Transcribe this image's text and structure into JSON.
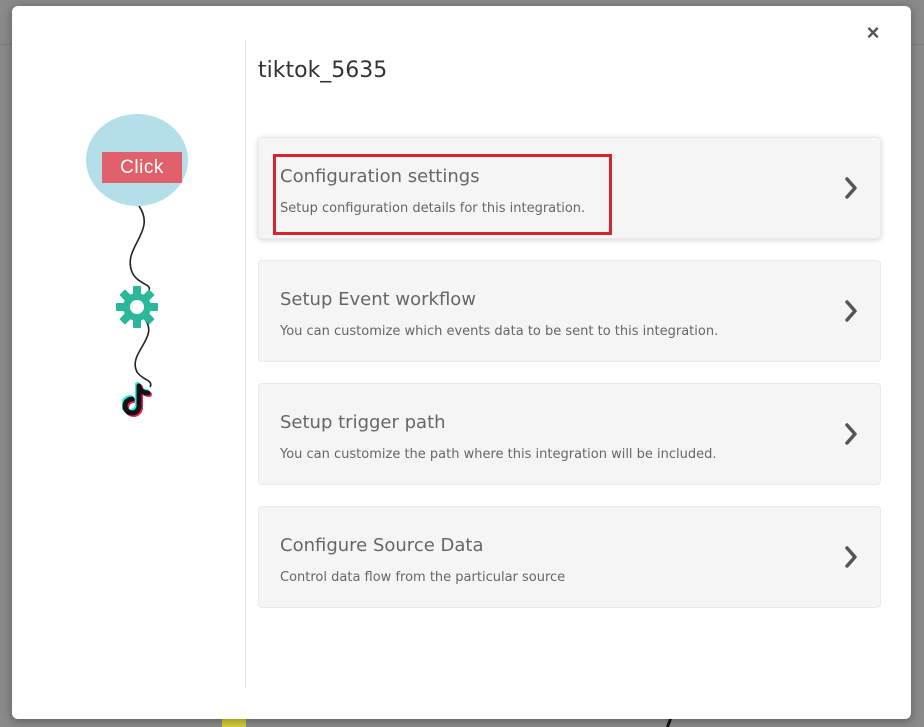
{
  "modal": {
    "title": "tiktok_5635",
    "close_label": "×"
  },
  "flow": {
    "start_label": "Click",
    "icons": [
      "click-node",
      "gear-icon",
      "tiktok-icon"
    ]
  },
  "cards": [
    {
      "title": "Configuration settings",
      "description": "Setup configuration details for this integration.",
      "highlighted": true
    },
    {
      "title": "Setup Event workflow",
      "description": "You can customize which events data to be sent to this integration."
    },
    {
      "title": "Setup trigger path",
      "description": "You can customize the path where this integration will be included."
    },
    {
      "title": "Configure Source Data",
      "description": "Control data flow from the particular source"
    }
  ],
  "colors": {
    "highlight": "#d9232d",
    "click_button": "#e0606b",
    "click_circle": "#b4dfe8",
    "gear": "#2bb89a"
  }
}
